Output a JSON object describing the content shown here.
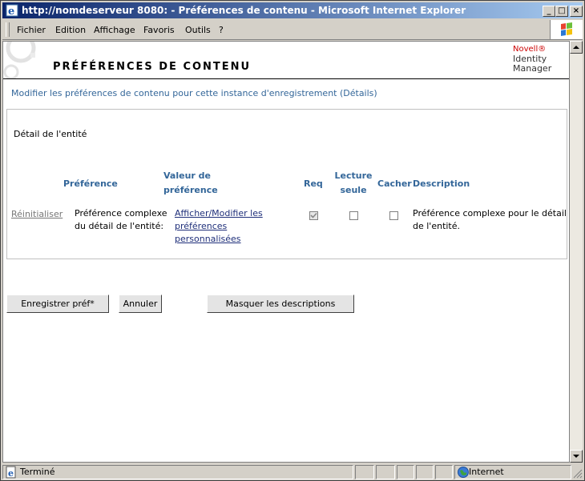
{
  "window": {
    "title": "http://nomdeserveur 8080: - Préférences de contenu - Microsoft Internet Explorer",
    "minimize": "_",
    "maximize": "□",
    "close": "×"
  },
  "menu": {
    "items": [
      "Fichier",
      "Edition",
      "Affichage",
      "Favoris",
      "Outils",
      "?"
    ]
  },
  "header": {
    "page_title": "PRÉFÉRENCES DE CONTENU",
    "brand_novell": "Novell®",
    "brand_line1": "Identity",
    "brand_line2": "Manager"
  },
  "subtitle": "Modifier les préférences de contenu pour cette instance d'enregistrement (Détails)",
  "panel": {
    "entity_label": "Détail de l'entité",
    "columns": {
      "preference": "Préférence",
      "value_line1": "Valeur de",
      "value_line2": "préférence",
      "req": "Req",
      "readonly_line1": "Lecture",
      "readonly_line2": "seule",
      "hide": "Cacher",
      "description": "Description"
    },
    "row": {
      "reset": "Réinitialiser",
      "pref_line1": "Préférence complexe",
      "pref_line2": "du détail de l'entité:",
      "link_line1": "Afficher/Modifier les",
      "link_line2": "préférences",
      "link_line3": "personnalisées",
      "req_checked": true,
      "readonly_checked": false,
      "hide_checked": false,
      "desc_line1": "Préférence complexe pour le détail",
      "desc_line2": "de l'entité."
    }
  },
  "buttons": {
    "save": "Enregistrer préf*",
    "cancel": "Annuler",
    "hide_desc": "Masquer les descriptions"
  },
  "status": {
    "text": "Terminé",
    "zone": "Internet"
  }
}
